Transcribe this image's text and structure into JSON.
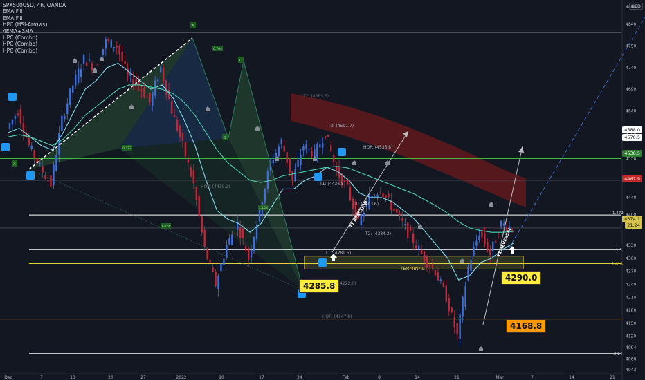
{
  "header": {
    "symbol": "SPX500USD, 4h, OANDA",
    "legend": [
      "EMA Fill",
      "EMA Fill",
      "HPC (HSI-Arrows)",
      "4EMA+3MA",
      "HPC (Combo)",
      "HPC (Combo)",
      "HPC (Combo)"
    ],
    "currency": "USD"
  },
  "price_tags": [
    {
      "label": "4588.0",
      "bg": "#ffffff",
      "fg": "#131722"
    },
    {
      "label": "4570.5",
      "bg": "#ffffff",
      "fg": "#131722"
    },
    {
      "label": "4530.5",
      "bg": "#2e7d32",
      "fg": "#ffffff"
    },
    {
      "label": "4467.9",
      "bg": "#c62828",
      "fg": "#ffffff"
    },
    {
      "label": "4374.1",
      "bg": "#d4c24a",
      "fg": "#131722"
    },
    {
      "label": "21:24",
      "bg": "#d4c24a",
      "fg": "#131722"
    }
  ],
  "callouts": [
    {
      "label": "4285.8",
      "bg": "#ffeb3b"
    },
    {
      "label": "4290.0",
      "bg": "#ffeb3b"
    },
    {
      "label": "4168.8",
      "bg": "#ff9800"
    }
  ],
  "annotations": {
    "terminal": "TERMINAL",
    "t1_reaction": "T1 REACTION",
    "t1_reversal": "T1 REVERSAL",
    "hop_4439": "HOP: (4439.2)",
    "hop_4535": "HOP: (4535.8)",
    "hop_4147": "HOP: (4147.8)",
    "t2_4591": "T2: (4591.7)",
    "t1_4403": "T1: (4403.6)",
    "t2_4334": "T2: (4334.2)",
    "t1_4289": "T1: (4289.5)",
    "terminal_4222": "(terminal): (4222.0)",
    "t2_4663": "T2: (4663.6)",
    "t1_4436": "T1: (4436.5)",
    "fib_1272": "1.272",
    "fib_15": "1.5",
    "fib_1618": "1.618",
    "fib_224": "2.24",
    "ratio_0704": "0.704",
    "ratio_0722": "0.722",
    "ratio_1165": "1.165",
    "ratio_1824": "1.824",
    "point_a": "A",
    "point_b": "B",
    "point_c": "C",
    "point_x": "X"
  },
  "chart_data": {
    "type": "line",
    "title": "SPX500USD, 4h, OANDA",
    "ylim": [
      4043,
      4880
    ],
    "y_ticks": [
      4880,
      4840,
      4790,
      4740,
      4690,
      4640,
      4588,
      4530,
      4480,
      4440,
      4400,
      4370,
      4330,
      4300,
      4270,
      4240,
      4210,
      4180,
      4150,
      4120,
      4094,
      4068,
      4043
    ],
    "x_ticks": [
      "Dec",
      "7",
      "13",
      "20",
      "27",
      "2022",
      "10",
      "17",
      "24",
      "Feb",
      "8",
      "14",
      "21",
      "Mar",
      "7",
      "14",
      "21"
    ],
    "series": [
      {
        "values": [
          4600,
          4640,
          4560,
          4510,
          4470,
          4620,
          4700,
          4760,
          4740,
          4800,
          4790,
          4720,
          4700,
          4660,
          4740,
          4640,
          4560,
          4470,
          4320,
          4240,
          4330,
          4380,
          4300,
          4410,
          4520,
          4570,
          4480,
          4560,
          4540,
          4590,
          4500,
          4460,
          4380,
          4440,
          4460,
          4420,
          4380,
          4340,
          4300,
          4270,
          4210,
          4120,
          4280,
          4360,
          4310,
          4380,
          4370
        ]
      },
      {
        "values": [
          4590,
          4600,
          4580,
          4560,
          4550,
          4590,
          4640,
          4690,
          4710,
          4740,
          4750,
          4730,
          4710,
          4690,
          4700,
          4670,
          4620,
          4560,
          4480,
          4410,
          4390,
          4380,
          4360,
          4380,
          4420,
          4460,
          4460,
          4480,
          4490,
          4510,
          4500,
          4480,
          4450,
          4440,
          4440,
          4430,
          4410,
          4390,
          4360,
          4330,
          4300,
          4250,
          4260,
          4290,
          4300,
          4320,
          4335
        ]
      },
      {
        "values": [
          4580,
          4585,
          4580,
          4570,
          4560,
          4575,
          4600,
          4630,
          4650,
          4670,
          4690,
          4700,
          4700,
          4695,
          4690,
          4680,
          4660,
          4630,
          4590,
          4550,
          4520,
          4500,
          4480,
          4475,
          4480,
          4490,
          4495,
          4500,
          4505,
          4510,
          4512,
          4508,
          4498,
          4488,
          4478,
          4468,
          4458,
          4448,
          4434,
          4420,
          4404,
          4384,
          4370,
          4364,
          4360,
          4360,
          4362
        ]
      }
    ]
  }
}
